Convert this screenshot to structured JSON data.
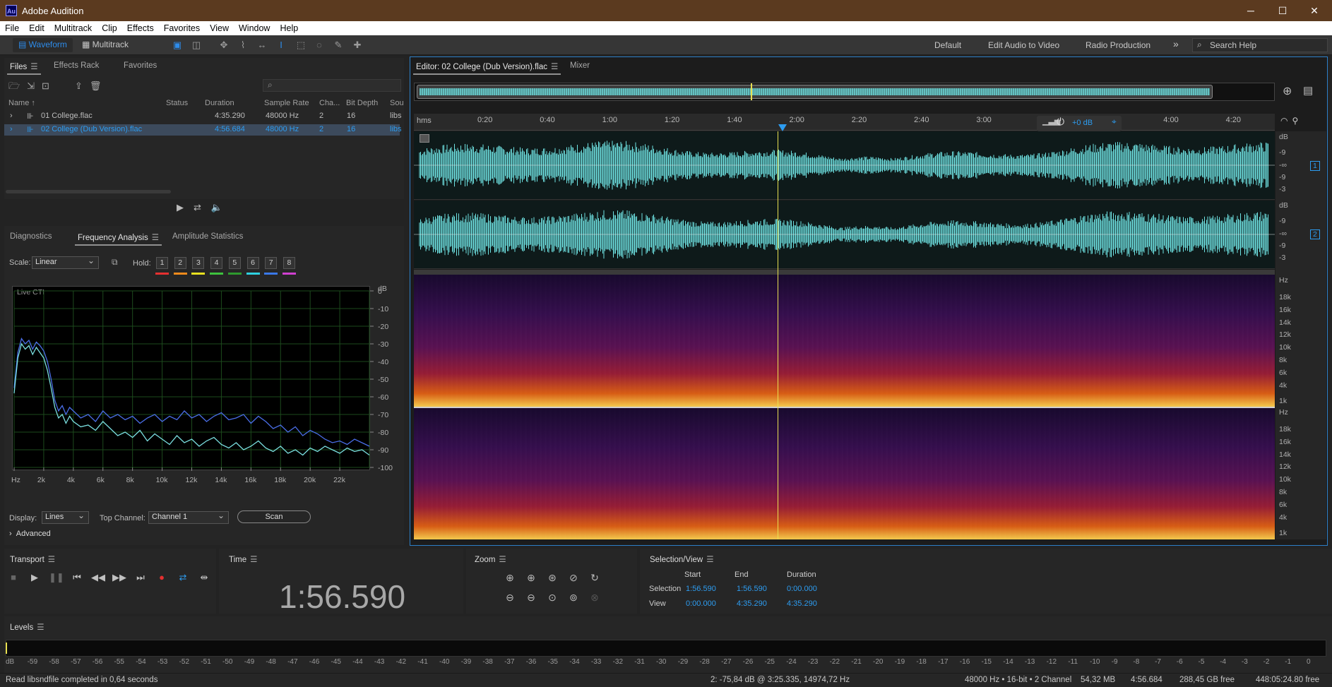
{
  "window": {
    "app_icon": "Au",
    "title": "Adobe Audition"
  },
  "menu": [
    "File",
    "Edit",
    "Multitrack",
    "Clip",
    "Effects",
    "Favorites",
    "View",
    "Window",
    "Help"
  ],
  "toolbar": {
    "waveform": "Waveform",
    "multitrack": "Multitrack",
    "workspaces": [
      "Default",
      "Edit Audio to Video",
      "Radio Production"
    ],
    "more": "»",
    "search_placeholder": "Search Help"
  },
  "files_panel": {
    "tabs": [
      "Files",
      "Effects Rack",
      "Favorites"
    ],
    "columns": [
      "Name",
      "Status",
      "Duration",
      "Sample Rate",
      "Cha...",
      "Bit Depth",
      "Sou"
    ],
    "rows": [
      {
        "name": "01 College.flac",
        "status": "",
        "duration": "4:35.290",
        "sample_rate": "48000 Hz",
        "channels": "2",
        "bit_depth": "16",
        "source": "libs"
      },
      {
        "name": "02 College (Dub Version).flac",
        "status": "",
        "duration": "4:56.684",
        "sample_rate": "48000 Hz",
        "channels": "2",
        "bit_depth": "16",
        "source": "libs"
      }
    ]
  },
  "analysis_panel": {
    "tabs": [
      "Diagnostics",
      "Frequency Analysis",
      "Amplitude Statistics"
    ],
    "scale_label": "Scale:",
    "scale_value": "Linear",
    "hold_label": "Hold:",
    "hold": [
      "1",
      "2",
      "3",
      "4",
      "5",
      "6",
      "7",
      "8"
    ],
    "hold_colors": [
      "#e53030",
      "#f08a1c",
      "#e8e020",
      "#3ec23e",
      "#2e9a2e",
      "#2ed0e0",
      "#3a78e8",
      "#d040d0"
    ],
    "live_label": "Live CTI",
    "display_label": "Display:",
    "display_value": "Lines",
    "top_channel_label": "Top Channel:",
    "top_channel_value": "Channel 1",
    "scan_button": "Scan",
    "advanced": "Advanced"
  },
  "chart_data": {
    "type": "line",
    "title": "",
    "xlabel": "Hz",
    "ylabel": "dB",
    "x_ticks": [
      "Hz",
      "2k",
      "4k",
      "6k",
      "8k",
      "10k",
      "12k",
      "14k",
      "16k",
      "18k",
      "20k",
      "22k"
    ],
    "y_ticks": [
      "0",
      "-10",
      "-20",
      "-30",
      "-40",
      "-50",
      "-60",
      "-70",
      "-80",
      "-90",
      "-100"
    ],
    "xlim": [
      0,
      24000
    ],
    "ylim": [
      -100,
      0
    ],
    "series": [
      {
        "color": "#4a6ee8",
        "x": [
          0,
          250,
          500,
          750,
          1000,
          1250,
          1500,
          1750,
          2000,
          2250,
          2500,
          2750,
          3000,
          3250,
          3500,
          3750,
          4000,
          4500,
          5000,
          5500,
          6000,
          6500,
          7000,
          7500,
          8000,
          8500,
          9000,
          9500,
          10000,
          10500,
          11000,
          11500,
          12000,
          12500,
          13000,
          13500,
          14000,
          14500,
          15000,
          15500,
          16000,
          16500,
          17000,
          17500,
          18000,
          18500,
          19000,
          19500,
          20000,
          20500,
          21000,
          21500,
          22000,
          22500,
          23000,
          23500,
          24000
        ],
        "y": [
          -55,
          -35,
          -27,
          -30,
          -28,
          -33,
          -29,
          -31,
          -34,
          -40,
          -50,
          -62,
          -68,
          -65,
          -70,
          -66,
          -68,
          -72,
          -70,
          -74,
          -68,
          -72,
          -70,
          -73,
          -71,
          -75,
          -72,
          -70,
          -74,
          -71,
          -73,
          -68,
          -72,
          -70,
          -74,
          -71,
          -69,
          -73,
          -72,
          -70,
          -75,
          -71,
          -74,
          -78,
          -76,
          -80,
          -77,
          -82,
          -79,
          -81,
          -84,
          -86,
          -85,
          -87,
          -84,
          -86,
          -88
        ]
      },
      {
        "color": "#7adfe0",
        "x": [
          0,
          250,
          500,
          750,
          1000,
          1250,
          1500,
          1750,
          2000,
          2250,
          2500,
          2750,
          3000,
          3250,
          3500,
          3750,
          4000,
          4500,
          5000,
          5500,
          6000,
          6500,
          7000,
          7500,
          8000,
          8500,
          9000,
          9500,
          10000,
          10500,
          11000,
          11500,
          12000,
          12500,
          13000,
          13500,
          14000,
          14500,
          15000,
          15500,
          16000,
          16500,
          17000,
          17500,
          18000,
          18500,
          19000,
          19500,
          20000,
          20500,
          21000,
          21500,
          22000,
          22500,
          23000,
          23500,
          24000
        ],
        "y": [
          -58,
          -38,
          -30,
          -33,
          -31,
          -36,
          -32,
          -35,
          -38,
          -45,
          -55,
          -66,
          -72,
          -70,
          -75,
          -71,
          -74,
          -77,
          -76,
          -79,
          -74,
          -78,
          -82,
          -80,
          -83,
          -79,
          -85,
          -81,
          -84,
          -87,
          -82,
          -86,
          -84,
          -88,
          -85,
          -83,
          -87,
          -89,
          -86,
          -90,
          -88,
          -85,
          -89,
          -91,
          -88,
          -92,
          -90,
          -93,
          -89,
          -91,
          -88,
          -90,
          -92,
          -89,
          -91,
          -90,
          -93
        ]
      }
    ]
  },
  "editor": {
    "tab_title": "Editor: 02 College (Dub Version).flac",
    "mixer_tab": "Mixer",
    "ruler_unit": "hms",
    "ruler_ticks": [
      "0:20",
      "0:40",
      "1:00",
      "1:20",
      "1:40",
      "2:00",
      "2:20",
      "2:40",
      "3:00",
      "3:20",
      "3:40",
      "4:00",
      "4:20"
    ],
    "gain": "+0 dB",
    "db_labels": [
      "dB",
      "-9",
      "-∞",
      "-9",
      "-3"
    ],
    "channels": [
      "1",
      "2"
    ],
    "hz_labels": [
      "Hz",
      "18k",
      "16k",
      "14k",
      "12k",
      "10k",
      "8k",
      "6k",
      "4k",
      "1k"
    ]
  },
  "transport": {
    "label": "Transport"
  },
  "time": {
    "label": "Time",
    "value": "1:56.590"
  },
  "zoom": {
    "label": "Zoom"
  },
  "selection_view": {
    "label": "Selection/View",
    "headers": [
      "Start",
      "End",
      "Duration"
    ],
    "selection": {
      "label": "Selection",
      "start": "1:56.590",
      "end": "1:56.590",
      "duration": "0:00.000"
    },
    "view": {
      "label": "View",
      "start": "0:00.000",
      "end": "4:35.290",
      "duration": "4:35.290"
    }
  },
  "levels": {
    "label": "Levels",
    "ticks": [
      "dB",
      "-59",
      "-58",
      "-57",
      "-56",
      "-55",
      "-54",
      "-53",
      "-52",
      "-51",
      "-50",
      "-49",
      "-48",
      "-47",
      "-46",
      "-45",
      "-44",
      "-43",
      "-42",
      "-41",
      "-40",
      "-39",
      "-38",
      "-37",
      "-36",
      "-35",
      "-34",
      "-33",
      "-32",
      "-31",
      "-30",
      "-29",
      "-28",
      "-27",
      "-26",
      "-25",
      "-24",
      "-23",
      "-22",
      "-21",
      "-20",
      "-19",
      "-18",
      "-17",
      "-16",
      "-15",
      "-14",
      "-13",
      "-12",
      "-11",
      "-10",
      "-9",
      "-8",
      "-7",
      "-6",
      "-5",
      "-4",
      "-3",
      "-2",
      "-1",
      "0"
    ]
  },
  "status": {
    "message": "Read libsndfile completed in 0,64 seconds",
    "cursor": "2: -75,84 dB @ 3:25.335, 14974,72 Hz",
    "format": "48000 Hz • 16-bit • 2 Channel",
    "size": "54,32 MB",
    "duration": "4:56.684",
    "free": "288,45 GB free",
    "free_time": "448:05:24.80 free"
  },
  "colors": {
    "accent": "#2d8ceb",
    "waveform": "#6fe3e3",
    "playhead": "#e8e050",
    "title_bar": "#5b3a1f"
  }
}
